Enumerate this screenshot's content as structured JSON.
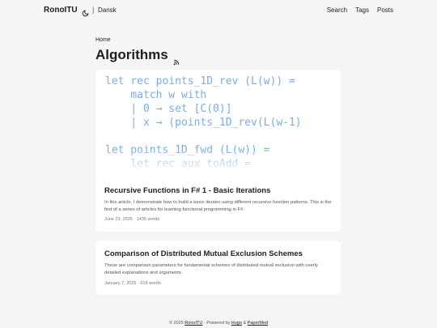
{
  "header": {
    "site_title": "RonoITU",
    "theme_toggle_icon": "moon-icon",
    "separator": "|",
    "language_link": "Dansk",
    "menu": [
      "Search",
      "Tags",
      "Posts"
    ]
  },
  "breadcrumb": "Home",
  "page": {
    "title": "Algorithms",
    "rss_icon": "rss-icon"
  },
  "posts": [
    {
      "cover_code": "let rec points_1D_rev (L(w)) =\n    match w with\n    | 0 → set [C(0)]\n    | x → (points_1D_rev(L(w-1)\n\nlet points_1D_fwd (L(w)) =\n    let rec aux toAdd =",
      "title": "Recursive Functions in F# 1 - Basic Iterations",
      "summary": "In this article, I demonstrate how to build a basic iterator using different recursive function patterns. This is the first of a series of articles for learning functional programming in F#.",
      "meta": "June 23, 2025 · 1435 words"
    },
    {
      "title": "Comparison of Distributed Mutual Exclusion Schemes",
      "summary": "These are comparison parameters for fundamental schemes of distributed mutual exclusion with overly detailed explanations and arguments.",
      "meta": "January 7, 2025 · 618 words"
    }
  ],
  "footer": {
    "copyright": "© 2025",
    "site_link": "RonoITU",
    "powered_by": "· Powered by",
    "hugo_link": "Hugo",
    "and": "&",
    "theme_link": "PaperMod"
  },
  "colors": {
    "background": "#f5f5f5",
    "card": "#ffffff",
    "code_blue": "#7aaee6"
  }
}
